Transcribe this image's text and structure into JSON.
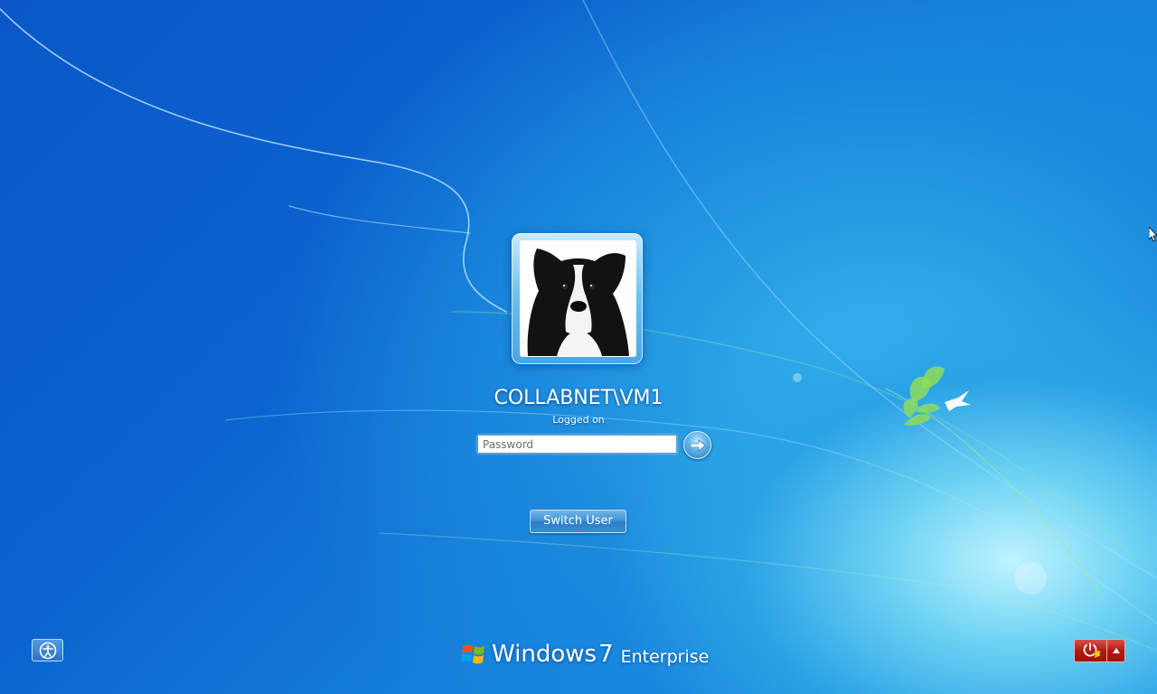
{
  "user": {
    "name": "COLLABNET\\VM1",
    "status": "Logged on"
  },
  "password": {
    "placeholder": "Password",
    "value": ""
  },
  "buttons": {
    "switch_user": "Switch User"
  },
  "branding": {
    "windows": "Windows",
    "version": "7",
    "edition": "Enterprise"
  },
  "icons": {
    "ease_of_access": "ease-of-access-icon",
    "submit": "arrow-right-icon",
    "shutdown": "shutdown-icon",
    "shutdown_menu": "triangle-up-icon",
    "avatar": "dog-avatar",
    "logo": "windows-flag-icon"
  },
  "colors": {
    "background": "#0c63cf",
    "shutdown": "#b01c14"
  }
}
